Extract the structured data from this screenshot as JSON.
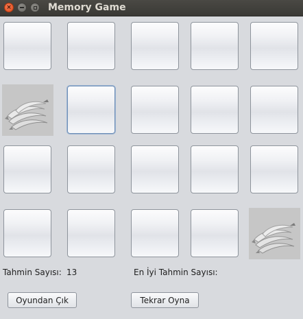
{
  "window": {
    "title": "Memory Game",
    "controls": {
      "close_glyph": "×"
    }
  },
  "board": {
    "rows": 4,
    "cols": 5,
    "focused_card": "row-2-col-2",
    "revealed_cards": [
      "row-2-col-1",
      "row-4-col-5"
    ],
    "revealed_image": "banana-image"
  },
  "stats": {
    "guess_count_label": "Tahmin Sayısı:",
    "guess_count_value": "13",
    "best_guess_label": "En İyi Tahmin Sayısı:",
    "best_guess_value": ""
  },
  "actions": {
    "quit_label": "Oyundan Çık",
    "replay_label": "Tekrar Oyna"
  }
}
